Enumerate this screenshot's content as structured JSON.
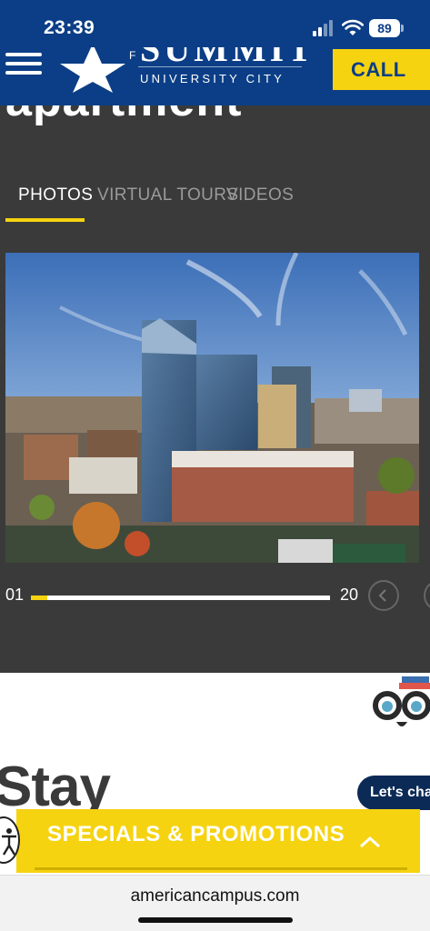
{
  "status_bar": {
    "time": "23:39",
    "battery": "89"
  },
  "header": {
    "logo_word": "SUMMIT",
    "logo_prefix": "F",
    "logo_sub": "UNIVERSITY CITY",
    "call_label": "CALL US"
  },
  "gallery": {
    "cut_heading": "apartment",
    "tabs": [
      {
        "label": "PHOTOS",
        "active": true
      },
      {
        "label": "VIRTUAL TOURS",
        "active": false
      },
      {
        "label": "VIDEOS",
        "active": false
      }
    ],
    "page_current": "01",
    "page_total": "20",
    "progress": 0.05
  },
  "content": {
    "stay_heading": "Stay"
  },
  "chat": {
    "label": "Let's chat"
  },
  "specials": {
    "label": "SPECIALS & PROMOTIONS"
  },
  "browser": {
    "url": "americancampus.com"
  },
  "colors": {
    "brand_blue": "#0b3e86",
    "accent_yellow": "#f6d311",
    "dark_bg": "#3a3a3a"
  }
}
